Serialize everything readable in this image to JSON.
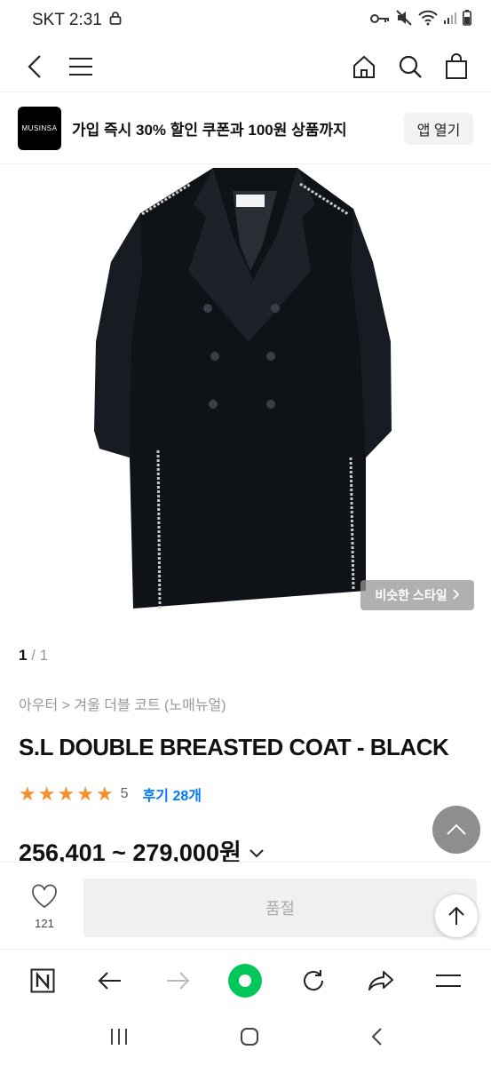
{
  "status": {
    "carrier_time": "SKT 2:31",
    "icons": [
      "lock-icon",
      "key-icon",
      "mute-icon",
      "wifi-icon",
      "signal-icon",
      "battery-icon"
    ]
  },
  "nav": {
    "icons": [
      "back-arrow-icon",
      "hamburger-menu-icon",
      "home-icon",
      "search-icon",
      "shopping-bag-icon"
    ]
  },
  "promo": {
    "logo_text": "MUSINSA",
    "text": "가입 즉시 30% 할인 쿠폰과 100원 상품까지",
    "open_label": "앱 열기"
  },
  "hero": {
    "similar_style_label": "비슷한 스타일"
  },
  "pager": {
    "current": "1",
    "total": "/ 1"
  },
  "breadcrumb": "아우터 > 겨울 더블 코트 (노매뉴얼)",
  "product": {
    "title": "S.L DOUBLE BREASTED COAT - BLACK",
    "rating_stars": 5,
    "rating_value": "5",
    "review_label": "후기 28개",
    "price_range": "256,401 ~ 279,000원"
  },
  "bottom": {
    "like_count": "121",
    "soldout_label": "품절"
  },
  "browser": {
    "icons": [
      "naver-n-icon",
      "back-icon",
      "forward-icon",
      "green-dot-home-icon",
      "refresh-icon",
      "share-icon",
      "menu-icon"
    ]
  },
  "system_nav": {
    "icons": [
      "recent-apps-icon",
      "home-circle-icon",
      "system-back-icon"
    ]
  },
  "colors": {
    "star": "#f5902c",
    "review_link": "#0078ff",
    "browser_green": "#03c75a"
  }
}
